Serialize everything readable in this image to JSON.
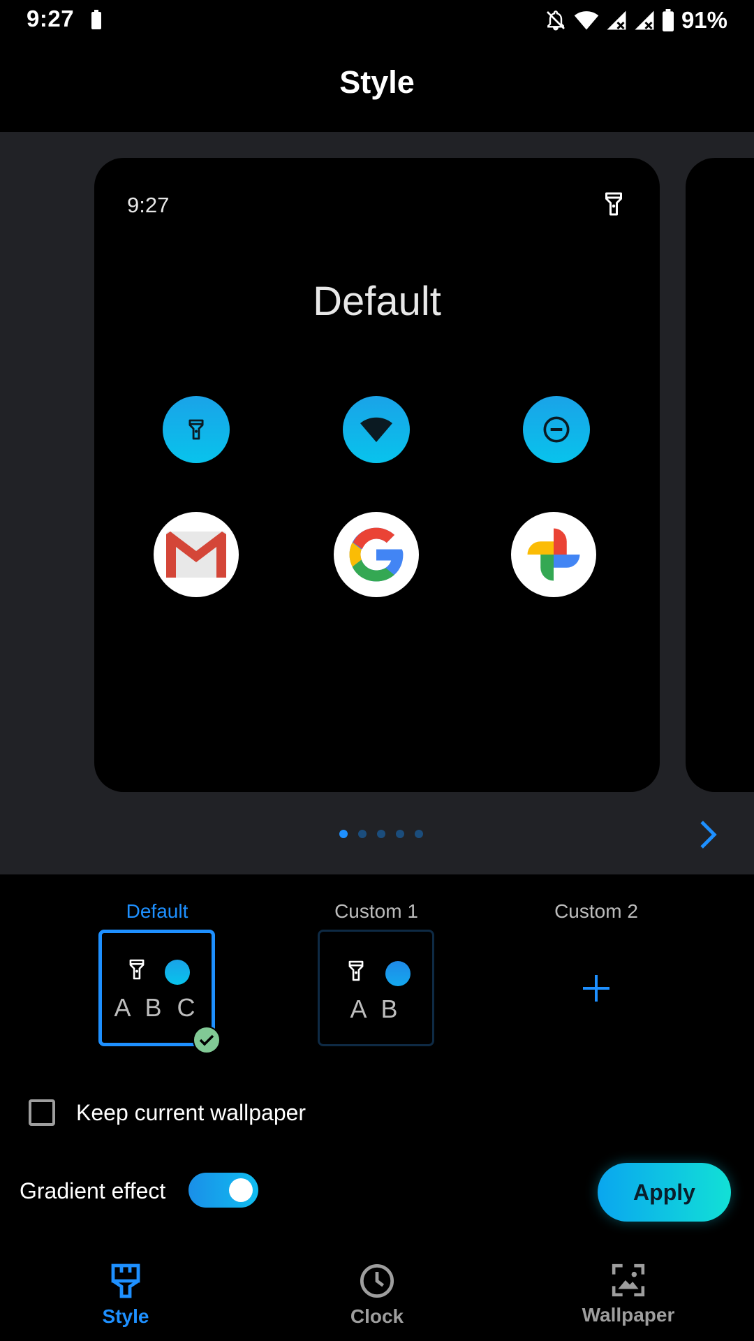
{
  "status_bar": {
    "time": "9:27",
    "battery_percent": "91%",
    "icons": [
      "battery-icon",
      "notifications-off-icon",
      "wifi-icon",
      "signal-icon",
      "signal-icon",
      "battery-icon"
    ]
  },
  "header": {
    "title": "Style"
  },
  "preview": {
    "time": "9:27",
    "title": "Default",
    "quick_settings": [
      "flashlight-icon",
      "wifi-icon",
      "dnd-icon"
    ],
    "apps": [
      "gmail-icon",
      "google-icon",
      "photos-icon"
    ],
    "page_count": 5,
    "current_page": 1
  },
  "style_options": [
    {
      "label": "Default",
      "preview_text": "A B C",
      "selected": true
    },
    {
      "label": "Custom 1",
      "preview_text": "A B",
      "selected": false
    },
    {
      "label": "Custom 2",
      "preview_text": "+",
      "selected": false
    }
  ],
  "options": {
    "keep_wallpaper_label": "Keep current wallpaper",
    "keep_wallpaper_checked": false,
    "gradient_label": "Gradient effect",
    "gradient_enabled": true
  },
  "apply_label": "Apply",
  "bottom_nav": [
    {
      "label": "Style",
      "icon": "brush-icon",
      "active": true
    },
    {
      "label": "Clock",
      "icon": "clock-icon",
      "active": false
    },
    {
      "label": "Wallpaper",
      "icon": "wallpaper-icon",
      "active": false
    }
  ],
  "colors": {
    "accent": "#1e90ff",
    "background": "#000000",
    "preview_bg": "#212226",
    "qs_tile": "#08c3ec"
  }
}
